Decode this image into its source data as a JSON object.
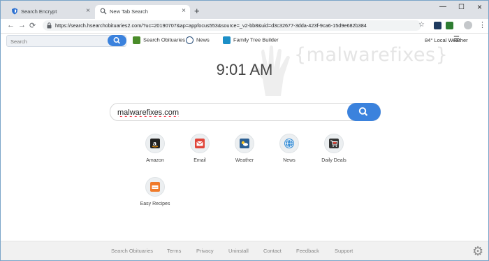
{
  "tabs": [
    {
      "label": "Search Encrypt",
      "icon": "shield-icon"
    },
    {
      "label": "New Tab Search",
      "icon": "search-icon"
    }
  ],
  "address_bar": {
    "url": "https://search.hsearchobituaries2.com/?uc=20190707&ap=appfocus553&source=_v2-bb8&uid=d3c32677-3dda-423f-9ca6-15d9e682b384"
  },
  "page_toolbar": {
    "search_placeholder": "Search",
    "links": [
      {
        "label": "Search Obituaries",
        "icon": "obituaries-icon"
      },
      {
        "label": "News",
        "icon": "news-icon"
      },
      {
        "label": "Family Tree Builder",
        "icon": "family-tree-icon"
      }
    ],
    "weather": "84° Local Weather"
  },
  "watermark": "{malwarefixes}",
  "clock": "9:01 AM",
  "main_search": {
    "value": "malwarefixes.com"
  },
  "tiles": [
    {
      "label": "Amazon",
      "icon": "amazon-icon"
    },
    {
      "label": "Email",
      "icon": "email-icon"
    },
    {
      "label": "Weather",
      "icon": "weather-icon"
    },
    {
      "label": "News",
      "icon": "globe-icon"
    },
    {
      "label": "Daily Deals",
      "icon": "cart-icon"
    },
    {
      "label": "Easy Recipes",
      "icon": "recipes-icon"
    }
  ],
  "footer": {
    "links": [
      "Search Obituaries",
      "Terms",
      "Privacy",
      "Uninstall",
      "Contact",
      "Feedback",
      "Support"
    ]
  },
  "colors": {
    "accent": "#3b82dd",
    "tabstrip": "#dee1e6",
    "footer_bg": "#f1f1f1"
  }
}
